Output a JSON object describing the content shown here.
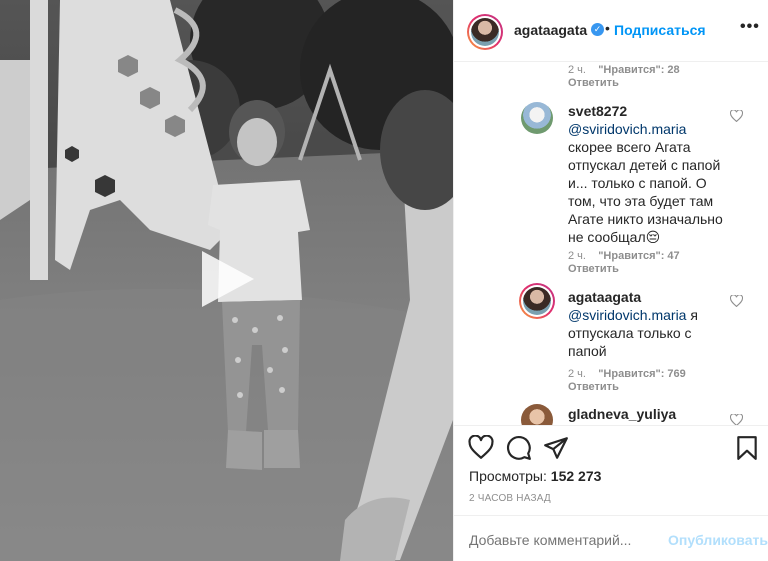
{
  "post": {
    "username": "agataagata",
    "verified_badge": "✓",
    "follow_label": "Подписаться",
    "more_label": "•••",
    "views_label": "Просмотры:",
    "views_count": "152 273",
    "posted_ago": "2 ЧАСОВ НАЗАД"
  },
  "comments": [
    {
      "meta_time": "2 ч.",
      "meta_likes": "\"Нравится\": 28",
      "reply_label": "Ответить"
    },
    {
      "username": "svet8272",
      "mention": "@sviridovich.maria",
      "text": "скорее всего Агата отпускал детей с папой и... только с папой. О том, что эта будет там Агате никто изначально не сообщал😔",
      "meta_time": "2 ч.",
      "meta_likes": "\"Нравится\": 47",
      "reply_label": "Ответить"
    },
    {
      "username": "agataagata",
      "mention": "@sviridovich.maria",
      "text": "я отпускала только с папой",
      "meta_time": "2 ч.",
      "meta_likes": "\"Нравится\": 769",
      "reply_label": "Ответить"
    },
    {
      "username": "gladneva_yuliya"
    }
  ],
  "add_comment": {
    "placeholder": "Добавьте комментарий...",
    "publish_label": "Опубликовать"
  },
  "icons": {
    "like": "heart-icon",
    "comment": "comment-icon",
    "share": "paper-plane-icon",
    "save": "bookmark-icon",
    "play": "play-icon",
    "comment_like": "heart-outline-icon",
    "more": "more-options-icon"
  },
  "colors": {
    "link": "#0095f6",
    "mention": "#00376b",
    "muted": "#8e8e8e",
    "publish_disabled": "#b2dffc"
  }
}
